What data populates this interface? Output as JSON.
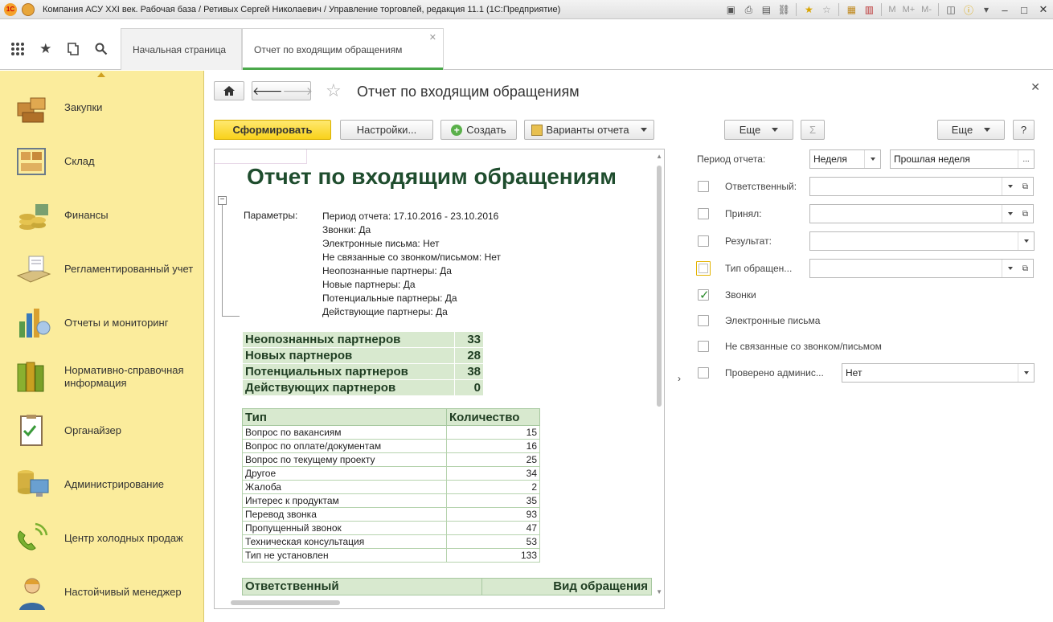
{
  "window": {
    "title": "Компания АСУ XXI век. Рабочая база / Ретивых Сергей Николаевич / Управление торговлей, редакция 11.1  (1С:Предприятие)",
    "logo_text": "1С",
    "m_labels": [
      "M",
      "M+",
      "M-"
    ]
  },
  "tabs": {
    "home": "Начальная страница",
    "report": "Отчет по входящим обращениям"
  },
  "sidebar": {
    "items": [
      {
        "label": "Закупки",
        "icon": "purchases-icon"
      },
      {
        "label": "Склад",
        "icon": "warehouse-icon"
      },
      {
        "label": "Финансы",
        "icon": "finance-icon"
      },
      {
        "label": "Регламентированный учет",
        "icon": "accounting-icon"
      },
      {
        "label": "Отчеты и мониторинг",
        "icon": "reports-icon"
      },
      {
        "label": "Нормативно-справочная информация",
        "icon": "reference-icon"
      },
      {
        "label": "Органайзер",
        "icon": "organizer-icon"
      },
      {
        "label": "Администрирование",
        "icon": "admin-icon"
      },
      {
        "label": "Центр холодных продаж",
        "icon": "cold-sales-icon"
      },
      {
        "label": "Настойчивый менеджер",
        "icon": "manager-icon"
      }
    ]
  },
  "form": {
    "title": "Отчет по входящим обращениям",
    "buttons": {
      "generate": "Сформировать",
      "settings": "Настройки...",
      "create": "Создать",
      "variants": "Варианты отчета",
      "more_left": "Еще",
      "more_right": "Еще",
      "sum": "Σ",
      "help": "?"
    }
  },
  "report": {
    "title": "Отчет по входящим обращениям",
    "params_label": "Параметры:",
    "params": [
      "Период отчета: 17.10.2016 - 23.10.2016",
      "Звонки: Да",
      "Электронные письма: Нет",
      "Не связанные со звонком/письмом: Нет",
      "Неопознанные партнеры: Да",
      "Новые партнеры: Да",
      "Потенциальные партнеры: Да",
      "Действующие партнеры: Да"
    ],
    "summary": [
      {
        "label": "Неопознанных партнеров",
        "value": "33"
      },
      {
        "label": "Новых партнеров",
        "value": "28"
      },
      {
        "label": "Потенциальных партнеров",
        "value": "38"
      },
      {
        "label": "Действующих партнеров",
        "value": "0"
      }
    ],
    "type_table": {
      "headers": [
        "Тип",
        "Количество"
      ],
      "rows": [
        [
          "Вопрос по вакансиям",
          "15"
        ],
        [
          "Вопрос по оплате/документам",
          "16"
        ],
        [
          "Вопрос по текущему проекту",
          "25"
        ],
        [
          "Другое",
          "34"
        ],
        [
          "Жалоба",
          "2"
        ],
        [
          "Интерес к продуктам",
          "35"
        ],
        [
          "Перевод звонка",
          "93"
        ],
        [
          "Пропущенный звонок",
          "47"
        ],
        [
          "Техническая консультация",
          "53"
        ],
        [
          "Тип не установлен",
          "133"
        ]
      ]
    },
    "responsible_headers": [
      "Ответственный",
      "Вид обращения"
    ]
  },
  "settings": {
    "period_label": "Период отчета:",
    "period_kind": "Неделя",
    "period_value": "Прошлая неделя",
    "rows": [
      {
        "label": "Ответственный:",
        "checked": false
      },
      {
        "label": "Принял:",
        "checked": false
      },
      {
        "label": "Результат:",
        "checked": false
      },
      {
        "label": "Тип обращен...",
        "checked": false
      },
      {
        "label": "Звонки",
        "checked": true
      },
      {
        "label": "Электронные письма",
        "checked": false
      },
      {
        "label": "Не связанные со звонком/письмом",
        "checked": false
      },
      {
        "label": "Проверено админис...",
        "checked": false,
        "value": "Нет"
      }
    ]
  }
}
